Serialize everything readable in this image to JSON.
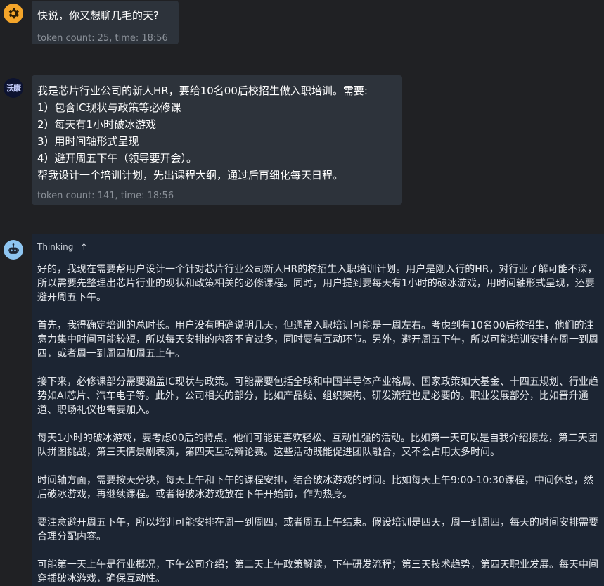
{
  "messages": [
    {
      "text": "快说，你又想聊几毛的天?",
      "meta": "token count: 25, time: 18:56"
    },
    {
      "avatar_text": "沃康",
      "lines": [
        "我是芯片行业公司的新人HR，要给10名00后校招生做入职培训。需要:",
        "1）包含IC现状与政策等必修课",
        "2）每天有1小时破冰游戏",
        "3）用时间轴形式呈现",
        "4）避开周五下午（领导要开会）。",
        "帮我设计一个培训计划，先出课程大纲，通过后再细化每天日程。"
      ],
      "meta": "token count: 141, time: 18:56"
    }
  ],
  "thinking": {
    "label": "Thinking",
    "toggle_icon": "↑",
    "paragraphs": [
      "好的，我现在需要帮用户设计一个针对芯片行业公司新人HR的校招生入职培训计划。用户是刚入行的HR，对行业了解可能不深，所以需要先整理出芯片行业的现状和政策相关的必修课程。同时，用户提到要每天有1小时的破冰游戏，用时间轴形式呈现，还要避开周五下午。",
      "首先，我得确定培训的总时长。用户没有明确说明几天，但通常入职培训可能是一周左右。考虑到有10名00后校招生，他们的注意力集中时间可能较短，所以每天安排的内容不宜过多，同时要有互动环节。另外，避开周五下午，所以可能培训安排在周一到周四，或者周一到周四加周五上午。",
      "接下来，必修课部分需要涵盖IC现状与政策。可能需要包括全球和中国半导体产业格局、国家政策如大基金、十四五规划、行业趋势如AI芯片、汽车电子等。此外，公司相关的部分，比如产品线、组织架构、研发流程也是必要的。职业发展部分，比如晋升通道、职场礼仪也需要加入。",
      "每天1小时的破冰游戏，要考虑00后的特点，他们可能更喜欢轻松、互动性强的活动。比如第一天可以是自我介绍接龙，第二天团队拼图挑战，第三天情景剧表演，第四天互动辩论赛。这些活动既能促进团队融合，又不会占用太多时间。",
      "时间轴方面，需要按天分块，每天上午和下午的课程安排，结合破冰游戏的时间。比如每天上午9:00-10:30课程，中间休息，然后破冰游戏，再继续课程。或者将破冰游戏放在下午开始前，作为热身。",
      "要注意避开周五下午，所以培训可能安排在周一到周四，或者周五上午结束。假设培训是四天，周一到周四，每天的时间安排需要合理分配内容。",
      "可能第一天上午是行业概况，下午公司介绍；第二天上午政策解读，下午研发流程；第三天技术趋势，第四天职业发展。每天中间穿插破冰游戏，确保互动性。"
    ]
  },
  "colors": {
    "background": "#202124",
    "bubble": "#2d333b",
    "thinking_panel": "#1c2533",
    "gear_avatar": "#f4a52a",
    "bot_avatar": "#8ec5f0"
  },
  "icons": [
    "gear-icon",
    "user-avatar",
    "robot-icon",
    "arrow-up-icon"
  ]
}
